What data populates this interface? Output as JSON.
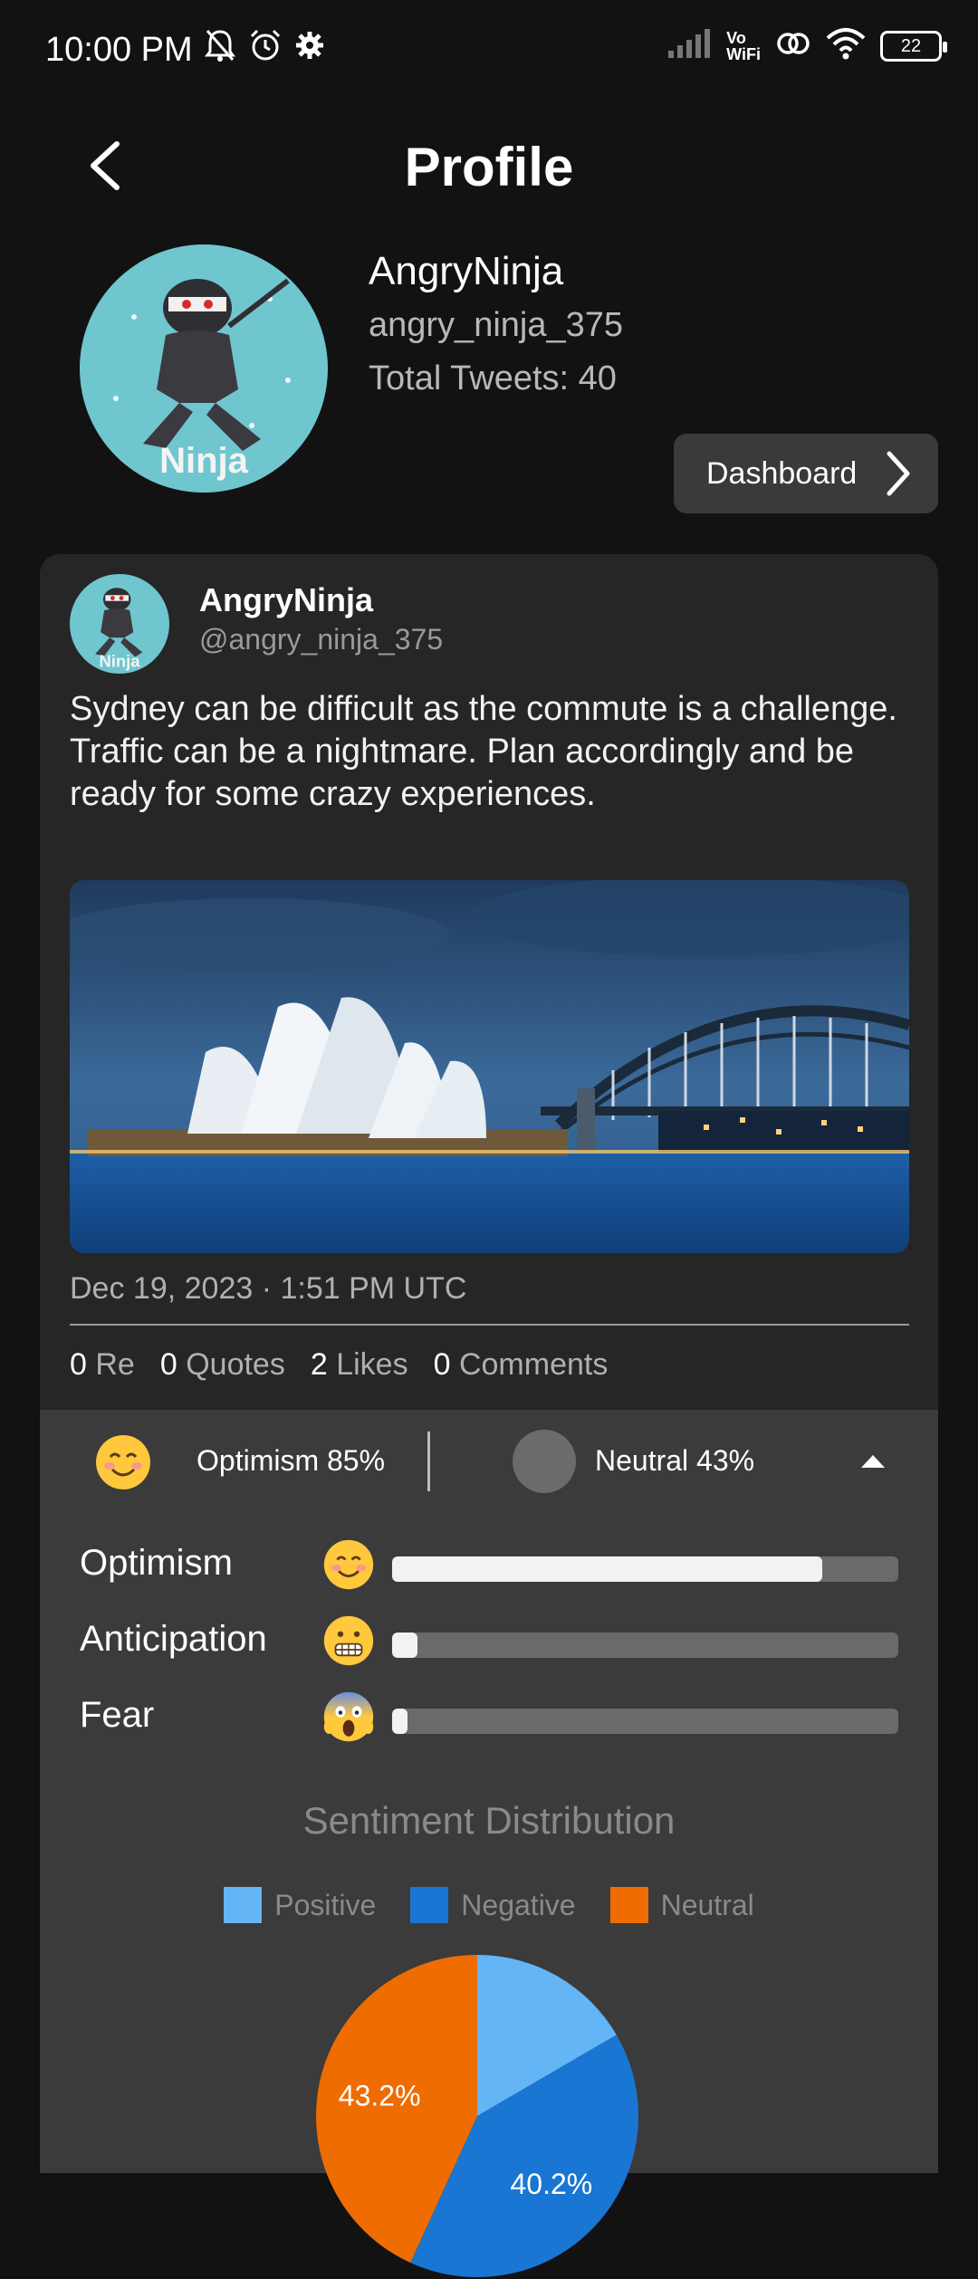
{
  "status": {
    "time": "10:00 PM",
    "battery": "22",
    "vowifi_top": "Vo",
    "vowifi_bottom": "WiFi"
  },
  "header": {
    "title": "Profile"
  },
  "profile": {
    "name": "AngryNinja",
    "handle": "angry_ninja_375",
    "total_tweets": "Total Tweets: 40",
    "avatar_text": "Ninja",
    "dashboard_label": "Dashboard"
  },
  "tweet": {
    "name": "AngryNinja",
    "handle": "@angry_ninja_375",
    "text": "Sydney can be difficult as the commute is a challenge. Traffic can be a nightmare. Plan accordingly and be ready for some crazy experiences.",
    "timestamp": "Dec 19, 2023 · 1:51 PM UTC",
    "stats": [
      {
        "count": "0",
        "label": "Re"
      },
      {
        "count": "0",
        "label": "Quotes"
      },
      {
        "count": "2",
        "label": "Likes"
      },
      {
        "count": "0",
        "label": "Comments"
      }
    ]
  },
  "sentiment": {
    "summary_emotion": "Optimism 85%",
    "summary_emotion_icon": "smiling-face-emoji",
    "summary_neutral": "Neutral 43%",
    "emotions": [
      {
        "label": "Optimism",
        "icon": "smiling-face-emoji",
        "glyph": "😊",
        "value": 0.85
      },
      {
        "label": "Anticipation",
        "icon": "grimacing-face-emoji",
        "glyph": "😬",
        "value": 0.05
      },
      {
        "label": "Fear",
        "icon": "screaming-face-emoji",
        "glyph": "😱",
        "value": 0.03
      }
    ]
  },
  "chart_data": {
    "type": "pie",
    "title": "Sentiment Distribution",
    "legend": [
      "Positive",
      "Negative",
      "Neutral"
    ],
    "categories": [
      "Positive",
      "Negative",
      "Neutral"
    ],
    "values": [
      16.6,
      40.2,
      43.2
    ],
    "labels": [
      "",
      "40.2%",
      "43.2%"
    ],
    "colors": [
      "#64b5f6",
      "#1976d2",
      "#ef6c00"
    ],
    "legend_position": "top"
  }
}
